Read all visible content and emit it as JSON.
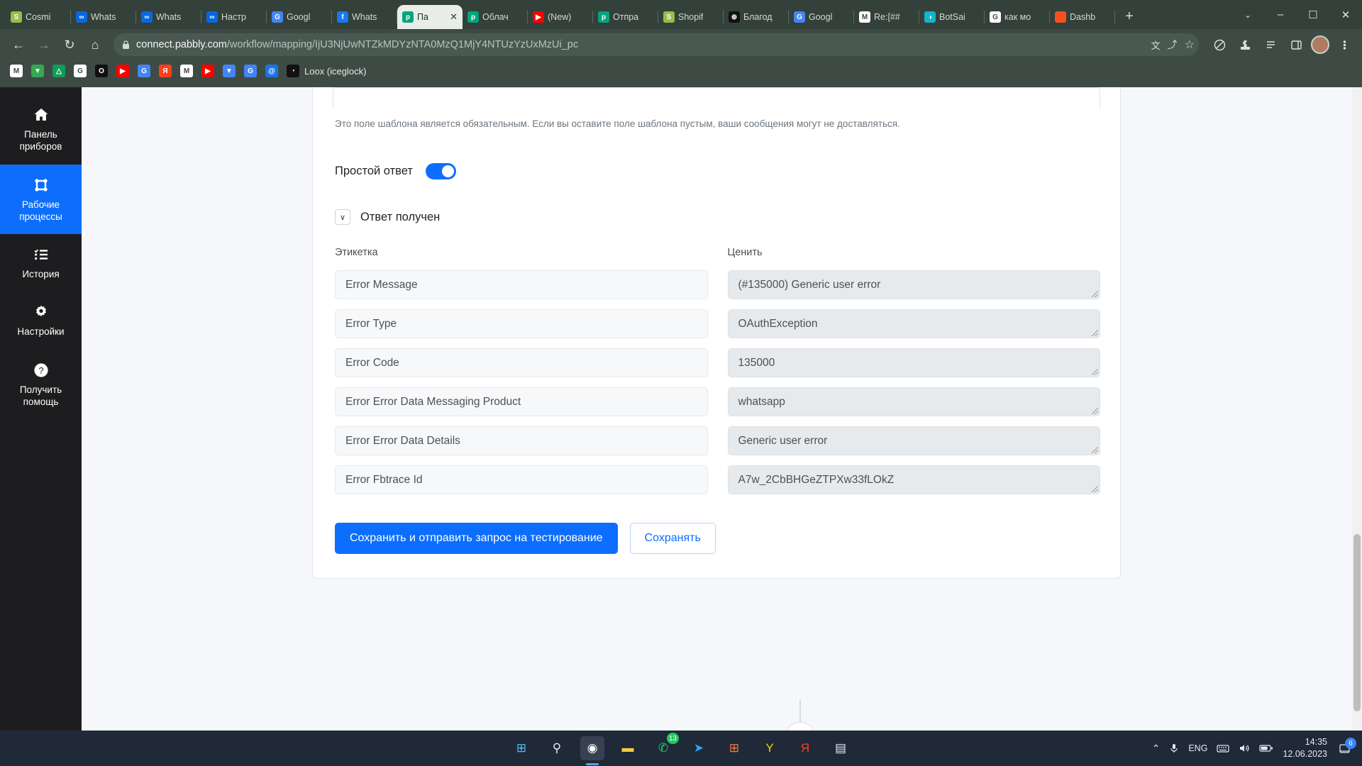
{
  "browser": {
    "tabs": [
      {
        "title": "Cosmi",
        "icon": "shopify-icon",
        "color": "#95bf47",
        "glyph": "S",
        "active": false
      },
      {
        "title": "Whats",
        "icon": "meta-icon",
        "color": "#0668E1",
        "glyph": "∞",
        "active": false
      },
      {
        "title": "Whats",
        "icon": "meta-icon",
        "color": "#0668E1",
        "glyph": "∞",
        "active": false
      },
      {
        "title": "Настр",
        "icon": "meta-icon",
        "color": "#0668E1",
        "glyph": "∞",
        "active": false
      },
      {
        "title": "Googl",
        "icon": "google-translate-icon",
        "color": "#4285F4",
        "glyph": "G",
        "active": false
      },
      {
        "title": "Whats",
        "icon": "facebook-icon",
        "color": "#1877F2",
        "glyph": "f",
        "active": false
      },
      {
        "title": "Па",
        "icon": "pabbly-icon",
        "color": "#00a67d",
        "glyph": "р",
        "active": true
      },
      {
        "title": "Облач",
        "icon": "pabbly-icon",
        "color": "#00a67d",
        "glyph": "р",
        "active": false
      },
      {
        "title": "(New)",
        "icon": "youtube-icon",
        "color": "#FF0000",
        "glyph": "▶",
        "active": false
      },
      {
        "title": "Отпра",
        "icon": "pabbly-icon",
        "color": "#00a67d",
        "glyph": "р",
        "active": false
      },
      {
        "title": "Shopif",
        "icon": "shopify-icon",
        "color": "#95bf47",
        "glyph": "S",
        "active": false
      },
      {
        "title": "Благод",
        "icon": "globe-icon",
        "color": "#111111",
        "glyph": "⊕",
        "active": false
      },
      {
        "title": "Googl",
        "icon": "google-translate-icon",
        "color": "#4285F4",
        "glyph": "G",
        "active": false
      },
      {
        "title": "Re:[##",
        "icon": "gmail-icon",
        "color": "#ffffff",
        "glyph": "M",
        "active": false
      },
      {
        "title": "BotSai",
        "icon": "bot-icon",
        "color": "#12b5cb",
        "glyph": "◑",
        "active": false
      },
      {
        "title": "как мо",
        "icon": "google-icon",
        "color": "#ffffff",
        "glyph": "G",
        "active": false
      },
      {
        "title": "Dashb",
        "icon": "orange-square-icon",
        "color": "#f4511e",
        "glyph": "",
        "active": false
      }
    ],
    "tab_close_label": "✕",
    "new_tab_label": "+",
    "tab_search_label": "⌄",
    "window_minimize": "–",
    "window_maximize": "☐",
    "window_close": "✕",
    "nav": {
      "back": "←",
      "forward": "→",
      "reload": "↻",
      "home": "⌂"
    },
    "omnibox": {
      "lock_icon": "lock-icon",
      "url_host": "connect.pabbly.com",
      "url_path": "/workflow/mapping/IjU3NjUwNTZkMDYzNTA0MzQ1MjY4NTUzYzUxMzUi_pc",
      "translate_icon": "文",
      "share_icon": "⤴",
      "bookmark_icon": "☆"
    },
    "toolbar_icons": [
      "shield-icon",
      "extensions-icon",
      "reading-list-icon",
      "side-panel-icon",
      "profile-avatar",
      "more-menu-icon"
    ],
    "bookmarks": [
      {
        "icon": "gmail-icon",
        "color": "#ffffff",
        "glyph": "M",
        "label": ""
      },
      {
        "icon": "google-maps-icon",
        "color": "#34a853",
        "glyph": "▼",
        "label": ""
      },
      {
        "icon": "google-drive-icon",
        "color": "#0f9d58",
        "glyph": "△",
        "label": ""
      },
      {
        "icon": "google-icon",
        "color": "#ffffff",
        "glyph": "G",
        "label": ""
      },
      {
        "icon": "opera-icon",
        "color": "#111111",
        "glyph": "O",
        "label": ""
      },
      {
        "icon": "youtube-icon",
        "color": "#FF0000",
        "glyph": "▶",
        "label": ""
      },
      {
        "icon": "google-translate-icon",
        "color": "#4285F4",
        "glyph": "G",
        "label": ""
      },
      {
        "icon": "yandex-icon",
        "color": "#fc3f1d",
        "glyph": "Я",
        "label": ""
      },
      {
        "icon": "gmail-icon",
        "color": "#ffffff",
        "glyph": "M",
        "label": ""
      },
      {
        "icon": "youtube-icon",
        "color": "#FF0000",
        "glyph": "▶",
        "label": ""
      },
      {
        "icon": "google-maps-icon",
        "color": "#4285F4",
        "glyph": "▼",
        "label": ""
      },
      {
        "icon": "google-translate-icon",
        "color": "#4285F4",
        "glyph": "G",
        "label": ""
      },
      {
        "icon": "email-at-icon",
        "color": "#1a73e8",
        "glyph": "@",
        "label": ""
      },
      {
        "icon": "loox-icon",
        "color": "#111111",
        "glyph": "◔",
        "label": "Loox (iceglock)"
      }
    ]
  },
  "sidebar": {
    "items": [
      {
        "icon": "home-icon",
        "label": "Панель приборов",
        "active": false
      },
      {
        "icon": "workflow-icon",
        "label": "Рабочие процессы",
        "active": true
      },
      {
        "icon": "history-icon",
        "label": "История",
        "active": false
      },
      {
        "icon": "gear-icon",
        "label": "Настройки",
        "active": false
      },
      {
        "icon": "help-icon",
        "label": "Получить помощь",
        "active": false
      }
    ],
    "accent_color": "#0d6efd"
  },
  "main": {
    "helper_text": "Это поле шаблона является обязательным. Если вы оставите поле шаблона пустым, ваши сообщения могут не доставляться.",
    "toggle_label": "Простой ответ",
    "toggle_on": true,
    "collapse_label": "Ответ получен",
    "collapse_chevron": "∨",
    "column_headers": {
      "label": "Этикетка",
      "value": "Ценить"
    },
    "rows": [
      {
        "label": "Error Message",
        "value": "(#135000) Generic user error"
      },
      {
        "label": "Error Type",
        "value": "OAuthException"
      },
      {
        "label": "Error Code",
        "value": "135000"
      },
      {
        "label": "Error Error Data Messaging Product",
        "value": "whatsapp"
      },
      {
        "label": "Error Error Data Details",
        "value": "Generic user error"
      },
      {
        "label": "Error Fbtrace Id",
        "value": "A7w_2CbBHGeZTPXw33fLOkZ"
      }
    ],
    "buttons": {
      "primary": "Сохранить и отправить запрос на тестирование",
      "secondary": "Сохранять"
    },
    "add_step_label": "+",
    "primary_color": "#0d6efd"
  },
  "taskbar": {
    "apps": [
      {
        "icon": "windows-start-icon",
        "color": "#4cc2ff",
        "glyph": "⊞",
        "badge": "",
        "active": false
      },
      {
        "icon": "search-icon",
        "color": "#e6ebf2",
        "glyph": "⚲",
        "badge": "",
        "active": false
      },
      {
        "icon": "chrome-icon",
        "color": "#ffffff",
        "glyph": "◉",
        "badge": "",
        "active": true
      },
      {
        "icon": "file-explorer-icon",
        "color": "#ffc845",
        "glyph": "▬",
        "badge": "",
        "active": false
      },
      {
        "icon": "whatsapp-icon",
        "color": "#25d366",
        "glyph": "✆",
        "badge": "13",
        "active": false
      },
      {
        "icon": "telegram-icon",
        "color": "#2aabee",
        "glyph": "➤",
        "badge": "",
        "active": false
      },
      {
        "icon": "microsoft-store-icon",
        "color": "#ff7a45",
        "glyph": "⊞",
        "badge": "",
        "active": false
      },
      {
        "icon": "yandex-browser-icon",
        "color": "#ffcc00",
        "glyph": "Y",
        "badge": "",
        "active": false
      },
      {
        "icon": "yandex-icon",
        "color": "#fc3f1d",
        "glyph": "Я",
        "badge": "",
        "active": false
      },
      {
        "icon": "calendar-icon",
        "color": "#e6ebf2",
        "glyph": "▤",
        "badge": "",
        "active": false
      }
    ],
    "tray": {
      "chevron": "⌃",
      "mic_icon": "microphone-icon",
      "language": "ENG",
      "keyboard_icon": "keyboard-icon",
      "volume_icon": "speaker-icon",
      "battery_icon": "battery-icon",
      "time": "14:35",
      "date": "12.06.2023",
      "notification_count": "6"
    }
  }
}
